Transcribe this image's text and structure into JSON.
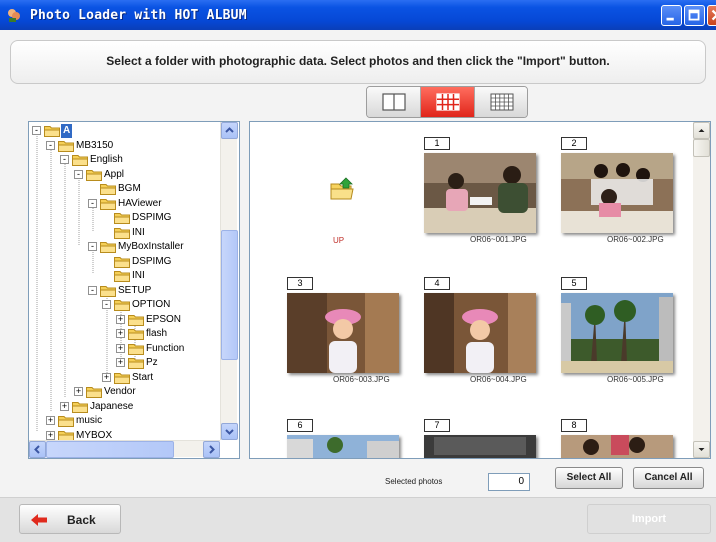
{
  "window": {
    "title": "Photo Loader with HOT ALBUM"
  },
  "instruction": "Select a folder with photographic data. Select photos and then click the \"Import\" button.",
  "view_toggle": {
    "options": [
      "single-view-icon",
      "medium-grid-icon",
      "large-grid-icon"
    ],
    "active_index": 1,
    "accent": "#e0251a"
  },
  "tree": {
    "nodes": [
      {
        "label": "A",
        "expander": "-",
        "selected": true
      },
      {
        "label": "MB3150",
        "expander": "-"
      },
      {
        "label": "English",
        "expander": "-"
      },
      {
        "label": "Appl",
        "expander": "-"
      },
      {
        "label": "BGM",
        "expander": ""
      },
      {
        "label": "HAViewer",
        "expander": "-"
      },
      {
        "label": "DSPIMG",
        "expander": ""
      },
      {
        "label": "INI",
        "expander": ""
      },
      {
        "label": "MyBoxInstaller",
        "expander": "-"
      },
      {
        "label": "DSPIMG",
        "expander": ""
      },
      {
        "label": "INI",
        "expander": ""
      },
      {
        "label": "SETUP",
        "expander": "-"
      },
      {
        "label": "OPTION",
        "expander": "-"
      },
      {
        "label": "EPSON",
        "expander": "+"
      },
      {
        "label": "flash",
        "expander": "+"
      },
      {
        "label": "Function",
        "expander": "+"
      },
      {
        "label": "Pz",
        "expander": "+"
      },
      {
        "label": "Start",
        "expander": "+"
      },
      {
        "label": "Vendor",
        "expander": "+"
      },
      {
        "label": "Japanese",
        "expander": "+"
      },
      {
        "label": "music",
        "expander": "+"
      },
      {
        "label": "MYBOX",
        "expander": "+"
      }
    ]
  },
  "photos": {
    "up_label": "UP",
    "items": [
      {
        "number": "1",
        "filename": "OR06~001.JPG"
      },
      {
        "number": "2",
        "filename": "OR06~002.JPG"
      },
      {
        "number": "3",
        "filename": "OR06~003.JPG"
      },
      {
        "number": "4",
        "filename": "OR06~004.JPG"
      },
      {
        "number": "5",
        "filename": "OR06~005.JPG"
      },
      {
        "number": "6",
        "filename": ""
      },
      {
        "number": "7",
        "filename": ""
      },
      {
        "number": "8",
        "filename": ""
      }
    ]
  },
  "selection": {
    "label": "Selected photos",
    "count": "0"
  },
  "buttons": {
    "select_all": "Select All",
    "cancel_all": "Cancel All",
    "back": "Back",
    "import": "Import"
  }
}
